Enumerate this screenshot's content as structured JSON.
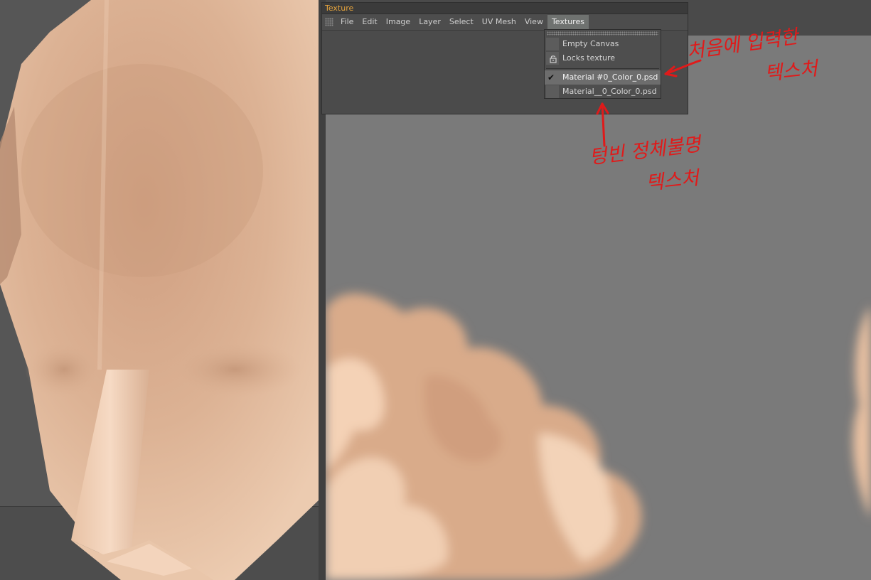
{
  "window": {
    "title": "Texture"
  },
  "menubar": {
    "items": [
      "File",
      "Edit",
      "Image",
      "Layer",
      "Select",
      "UV Mesh",
      "View",
      "Textures"
    ],
    "active": "Textures"
  },
  "textures_menu": {
    "items": {
      "empty_canvas": "Empty Canvas",
      "locks_texture": "Locks texture",
      "texture_1": "Material #0_Color_0.psd",
      "texture_2": "Material__0_Color_0.psd"
    },
    "checked": "Material #0_Color_0.psd"
  },
  "annotations": {
    "first_line_1": "처음에 입력한",
    "first_line_2": "텍스처",
    "second_line_1": "텅빈 정체불명",
    "second_line_2": "텍스처"
  },
  "colors": {
    "annotation": "#e01a1a",
    "title_accent": "#e6a43c",
    "skin": "#d9b093",
    "uv_background": "#7a7a7a"
  },
  "icons": {
    "checkmark": "check-icon",
    "lock": "lock-icon",
    "grip": "grip-icon"
  }
}
